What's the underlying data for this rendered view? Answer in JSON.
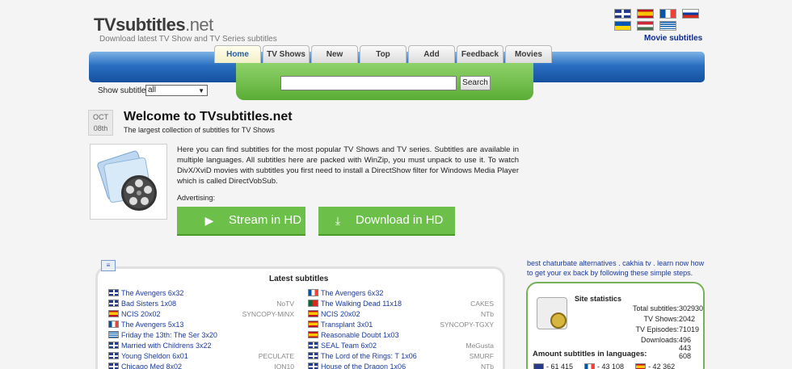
{
  "header": {
    "logo_main": "TVsubtitles",
    "logo_suffix": ".net",
    "tagline": "Download latest TV Show and TV Series subtitles",
    "movie_subtitles": "Movie subtitles"
  },
  "flags": [
    "gb",
    "es",
    "fr",
    "ru",
    "ua",
    "hu",
    "gr"
  ],
  "nav": {
    "tabs": [
      {
        "label": "Home",
        "active": true
      },
      {
        "label": "TV Shows"
      },
      {
        "label": "New"
      },
      {
        "label": "Top"
      },
      {
        "label": "Add"
      },
      {
        "label": "Feedback"
      },
      {
        "label": "Movies"
      }
    ],
    "search_button": "Search"
  },
  "filter": {
    "label": "Show subtitles",
    "selected": "all"
  },
  "post": {
    "date_month": "OCT",
    "date_day": "08th",
    "title": "Welcome to TVsubtitles.net",
    "subtitle": "The largest collection of subtitles for TV Shows",
    "intro": "Here you can find subtitles for the most popular TV Shows and TV series. Subtitles are available in multiple languages. All subtitles here are packed with WinZip, you must unpack to use it. To watch DivX/XviD movies with subtitles you first need to install a DirectShow filter for Windows Media Player which is called DirectVobSub.",
    "advertising": "Advertising:",
    "stream_label": "Stream in HD",
    "download_label": "Download in HD"
  },
  "latest": {
    "title": "Latest subtitles",
    "left": [
      {
        "flag": "gb",
        "title": "The Avengers 6x32",
        "release": ""
      },
      {
        "flag": "gb",
        "title": "Bad Sisters 1x08",
        "release": "NoTV"
      },
      {
        "flag": "es",
        "title": "NCIS 20x02",
        "release": "SYNCOPY-MiNX"
      },
      {
        "flag": "fr",
        "title": "The Avengers 5x13",
        "release": ""
      },
      {
        "flag": "gr",
        "title": "Friday the 13th: The Ser 3x20",
        "release": ""
      },
      {
        "flag": "gb",
        "title": "Married with Childrens 3x22",
        "release": ""
      },
      {
        "flag": "gb",
        "title": "Young Sheldon 6x01",
        "release": "PECULATE"
      },
      {
        "flag": "gb",
        "title": "Chicago Med 8x02",
        "release": "ION10"
      }
    ],
    "right": [
      {
        "flag": "fr",
        "title": "The Avengers 6x32",
        "release": ""
      },
      {
        "flag": "pt",
        "title": "The Walking Dead 11x18",
        "release": "CAKES"
      },
      {
        "flag": "es",
        "title": "NCIS 20x02",
        "release": "NTb"
      },
      {
        "flag": "es",
        "title": "Transplant 3x01",
        "release": "SYNCOPY-TGXY"
      },
      {
        "flag": "es",
        "title": "Reasonable Doubt 1x03",
        "release": ""
      },
      {
        "flag": "gb",
        "title": "SEAL Team 6x02",
        "release": "MeGusta"
      },
      {
        "flag": "gb",
        "title": "The Lord of the Rings: T 1x06",
        "release": "SMURF"
      },
      {
        "flag": "gb",
        "title": "House of the Dragon 1x06",
        "release": "NTb"
      }
    ]
  },
  "sidebar": {
    "links": "best chaturbate alternatives . cakhia tv . learn now how to get your ex back by following these simple steps.",
    "stats_title": "Site statistics",
    "stats": [
      {
        "label": "Total subtitles:",
        "value": "302930"
      },
      {
        "label": "TV Shows:",
        "value": "2042"
      },
      {
        "label": "TV Episodes:",
        "value": "71019"
      },
      {
        "label": "Downloads:",
        "value": "496 443 608"
      }
    ],
    "amount_title": "Amount subtitles in languages:",
    "languages": [
      {
        "flag": "gb",
        "count": "- 61 415"
      },
      {
        "flag": "fr",
        "count": "- 43 108"
      },
      {
        "flag": "es",
        "count": "- 42 362"
      }
    ]
  },
  "colors": {
    "nav_blue": "#2a6fc1",
    "search_green": "#6cc04a",
    "link": "#1a3a9c"
  }
}
